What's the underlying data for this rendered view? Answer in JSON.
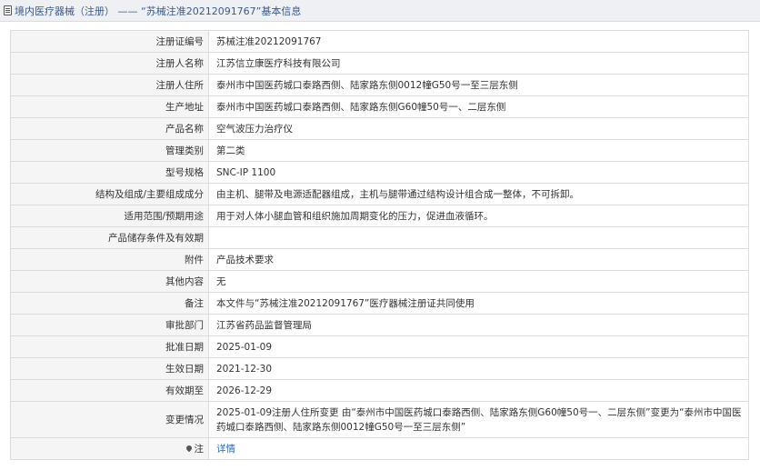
{
  "header": {
    "breadcrumb_prefix": "境内医疗器械（注册）",
    "separator": "——",
    "record_title": "“苏械注准20212091767”基本信息"
  },
  "rows": [
    {
      "key": "注册证编号",
      "value": "苏械注准20212091767"
    },
    {
      "key": "注册人名称",
      "value": "江苏信立康医疗科技有限公司"
    },
    {
      "key": "注册人住所",
      "value": "泰州市中国医药城口泰路西侧、陆家路东侧0012幢G50号一至三层东侧"
    },
    {
      "key": "生产地址",
      "value": "泰州市中国医药城口泰路西侧、陆家路东侧G60幢50号一、二层东侧"
    },
    {
      "key": "产品名称",
      "value": "空气波压力治疗仪"
    },
    {
      "key": "管理类别",
      "value": "第二类"
    },
    {
      "key": "型号规格",
      "value": "SNC-IP 1100"
    },
    {
      "key": "结构及组成/主要组成成分",
      "value": "由主机、腿带及电源适配器组成，主机与腿带通过结构设计组合成一整体，不可拆卸。"
    },
    {
      "key": "适用范围/预期用途",
      "value": "用于对人体小腿血管和组织施加周期变化的压力，促进血液循环。"
    },
    {
      "key": "产品储存条件及有效期",
      "value": ""
    },
    {
      "key": "附件",
      "value": "产品技术要求"
    },
    {
      "key": "其他内容",
      "value": "无"
    },
    {
      "key": "备注",
      "value": "本文件与“苏械注准20212091767”医疗器械注册证共同使用"
    },
    {
      "key": "审批部门",
      "value": "江苏省药品监督管理局"
    },
    {
      "key": "批准日期",
      "value": "2025-01-09"
    },
    {
      "key": "生效日期",
      "value": "2021-12-30"
    },
    {
      "key": "有效期至",
      "value": "2026-12-29"
    },
    {
      "key": "变更情况",
      "value": "2025-01-09注册人住所变更 由“泰州市中国医药城口泰路西侧、陆家路东侧G60幢50号一、二层东侧”变更为“泰州市中国医药城口泰路西侧、陆家路东侧0012幢G50号一至三层东侧”"
    }
  ],
  "note_row": {
    "key": "注",
    "link_label": "详情"
  },
  "icons": {
    "title_icon": "document-icon",
    "note_icon": "pin-icon"
  }
}
